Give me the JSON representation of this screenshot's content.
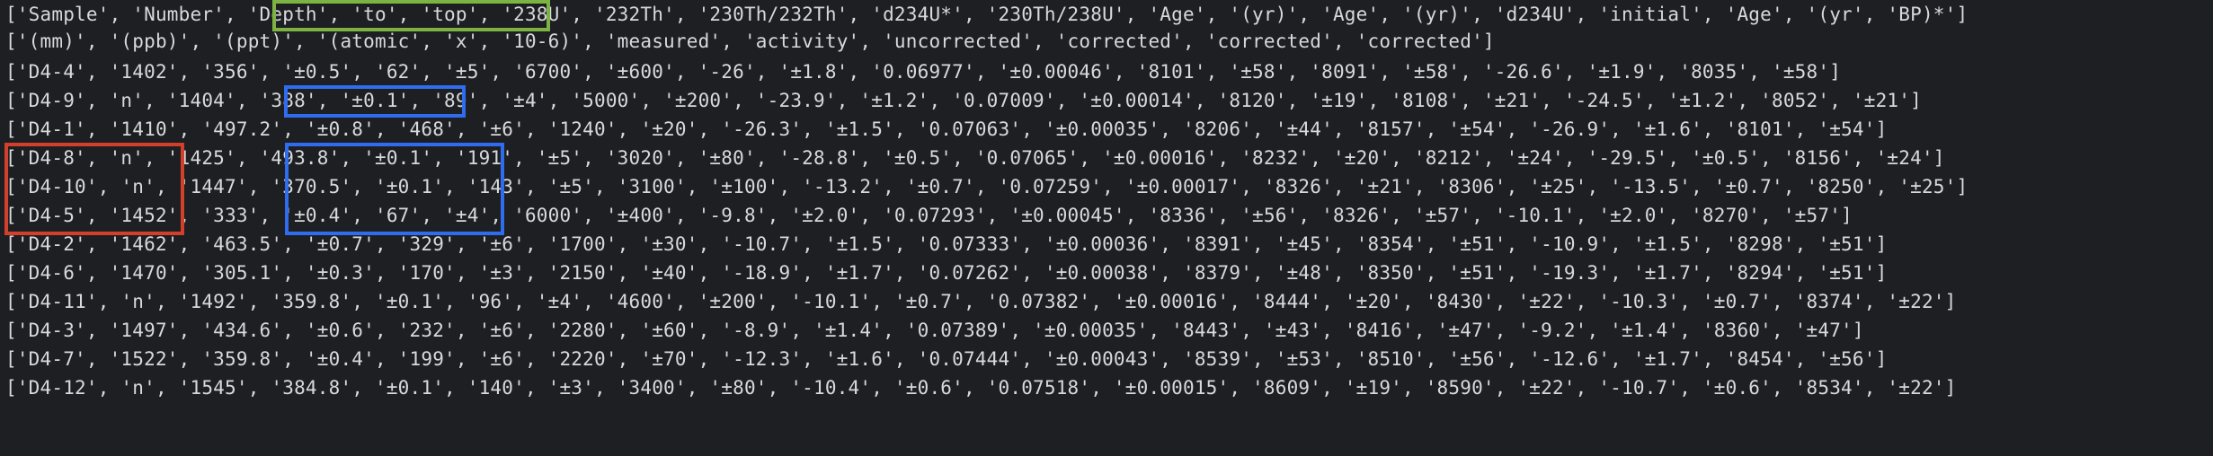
{
  "terminal": {
    "lines": [
      "['Sample', 'Number', 'Depth', 'to', 'top', '238U', '232Th', '230Th/232Th', 'd234U*', '230Th/238U', 'Age', '(yr)', 'Age', '(yr)', 'd234U', 'initial', 'Age', '(yr', 'BP)*']",
      "['(mm)', '(ppb)', '(ppt)', '(atomic', 'x', '10-6)', 'measured', 'activity', 'uncorrected', 'corrected', 'corrected', 'corrected']",
      "['D4-4', '1402', '356', '±0.5', '62', '±5', '6700', '±600', '-26', '±1.8', '0.06977', '±0.00046', '8101', '±58', '8091', '±58', '-26.6', '±1.9', '8035', '±58']",
      "['D4-9', 'n', '1404', '388', '±0.1', '89', '±4', '5000', '±200', '-23.9', '±1.2', '0.07009', '±0.00014', '8120', '±19', '8108', '±21', '-24.5', '±1.2', '8052', '±21']",
      "['D4-1', '1410', '497.2', '±0.8', '468', '±6', '1240', '±20', '-26.3', '±1.5', '0.07063', '±0.00035', '8206', '±44', '8157', '±54', '-26.9', '±1.6', '8101', '±54']",
      "['D4-8', 'n', '1425', '493.8', '±0.1', '191', '±5', '3020', '±80', '-28.8', '±0.5', '0.07065', '±0.00016', '8232', '±20', '8212', '±24', '-29.5', '±0.5', '8156', '±24']",
      "['D4-10', 'n', '1447', '370.5', '±0.1', '143', '±5', '3100', '±100', '-13.2', '±0.7', '0.07259', '±0.00017', '8326', '±21', '8306', '±25', '-13.5', '±0.7', '8250', '±25']",
      "['D4-5', '1452', '333', '±0.4', '67', '±4', '6000', '±400', '-9.8', '±2.0', '0.07293', '±0.00045', '8336', '±56', '8326', '±57', '-10.1', '±2.0', '8270', '±57']",
      "['D4-2', '1462', '463.5', '±0.7', '329', '±6', '1700', '±30', '-10.7', '±1.5', '0.07333', '±0.00036', '8391', '±45', '8354', '±51', '-10.9', '±1.5', '8298', '±51']",
      "['D4-6', '1470', '305.1', '±0.3', '170', '±3', '2150', '±40', '-18.9', '±1.7', '0.07262', '±0.00038', '8379', '±48', '8350', '±51', '-19.3', '±1.7', '8294', '±51']",
      "['D4-11', 'n', '1492', '359.8', '±0.1', '96', '±4', '4600', '±200', '-10.1', '±0.7', '0.07382', '±0.00016', '8444', '±20', '8430', '±22', '-10.3', '±0.7', '8374', '±22']",
      "['D4-3', '1497', '434.6', '±0.6', '232', '±6', '2280', '±60', '-8.9', '±1.4', '0.07389', '±0.00035', '8443', '±43', '8416', '±47', '-9.2', '±1.4', '8360', '±47']",
      "['D4-7', '1522', '359.8', '±0.4', '199', '±6', '2220', '±70', '-12.3', '±1.6', '0.07444', '±0.00043', '8539', '±53', '8510', '±56', '-12.6', '±1.7', '8454', '±56']",
      "['D4-12', 'n', '1545', '384.8', '±0.1', '140', '±3', '3400', '±80', '-10.4', '±0.6', '0.07518', '±0.00015', '8609', '±19', '8590', '±22', '-10.7', '±0.6', '8534', '±22']"
    ]
  },
  "highlights": {
    "colors": {
      "green": "#7cb342",
      "blue": "#2f6cf0",
      "red": "#d2402b"
    }
  }
}
